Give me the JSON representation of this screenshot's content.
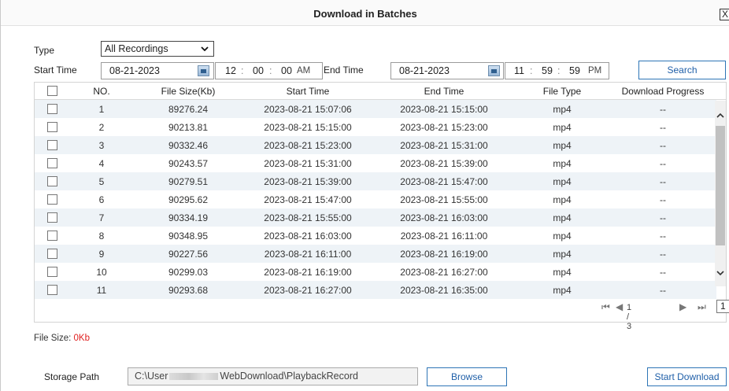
{
  "dialog": {
    "title": "Download in Batches",
    "close_label": "X"
  },
  "filters": {
    "type_label": "Type",
    "type_value": "All Recordings",
    "start_label": "Start Time",
    "start_date": "08-21-2023",
    "start_hh": "12",
    "start_mm": "00",
    "start_ss": "00",
    "start_ampm": "AM",
    "end_label": "End Time",
    "end_date": "08-21-2023",
    "end_hh": "11",
    "end_mm": "59",
    "end_ss": "59",
    "end_ampm": "PM",
    "time_sep": ":",
    "search_label": "Search"
  },
  "table": {
    "headers": {
      "no": "NO.",
      "size": "File Size(Kb)",
      "start": "Start Time",
      "end": "End Time",
      "type": "File Type",
      "progress": "Download Progress"
    },
    "rows": [
      {
        "no": "1",
        "size": "89276.24",
        "start": "2023-08-21 15:07:06",
        "end": "2023-08-21 15:15:00",
        "type": "mp4",
        "progress": "--"
      },
      {
        "no": "2",
        "size": "90213.81",
        "start": "2023-08-21 15:15:00",
        "end": "2023-08-21 15:23:00",
        "type": "mp4",
        "progress": "--"
      },
      {
        "no": "3",
        "size": "90332.46",
        "start": "2023-08-21 15:23:00",
        "end": "2023-08-21 15:31:00",
        "type": "mp4",
        "progress": "--"
      },
      {
        "no": "4",
        "size": "90243.57",
        "start": "2023-08-21 15:31:00",
        "end": "2023-08-21 15:39:00",
        "type": "mp4",
        "progress": "--"
      },
      {
        "no": "5",
        "size": "90279.51",
        "start": "2023-08-21 15:39:00",
        "end": "2023-08-21 15:47:00",
        "type": "mp4",
        "progress": "--"
      },
      {
        "no": "6",
        "size": "90295.62",
        "start": "2023-08-21 15:47:00",
        "end": "2023-08-21 15:55:00",
        "type": "mp4",
        "progress": "--"
      },
      {
        "no": "7",
        "size": "90334.19",
        "start": "2023-08-21 15:55:00",
        "end": "2023-08-21 16:03:00",
        "type": "mp4",
        "progress": "--"
      },
      {
        "no": "8",
        "size": "90348.95",
        "start": "2023-08-21 16:03:00",
        "end": "2023-08-21 16:11:00",
        "type": "mp4",
        "progress": "--"
      },
      {
        "no": "9",
        "size": "90227.56",
        "start": "2023-08-21 16:11:00",
        "end": "2023-08-21 16:19:00",
        "type": "mp4",
        "progress": "--"
      },
      {
        "no": "10",
        "size": "90299.03",
        "start": "2023-08-21 16:19:00",
        "end": "2023-08-21 16:27:00",
        "type": "mp4",
        "progress": "--"
      },
      {
        "no": "11",
        "size": "90293.68",
        "start": "2023-08-21 16:27:00",
        "end": "2023-08-21 16:35:00",
        "type": "mp4",
        "progress": "--"
      }
    ]
  },
  "pager": {
    "info": "1 / 3",
    "page_value": "1"
  },
  "footer": {
    "file_size_label": "File Size:",
    "file_size_value": "0Kb",
    "storage_label": "Storage Path",
    "path_prefix": "C:\\User",
    "path_suffix": "WebDownload\\PlaybackRecord",
    "browse_label": "Browse",
    "start_download_label": "Start Download"
  },
  "colors": {
    "accent": "#2e75b6",
    "row_alt": "#eef3f7",
    "file_size_value": "#e02020"
  }
}
